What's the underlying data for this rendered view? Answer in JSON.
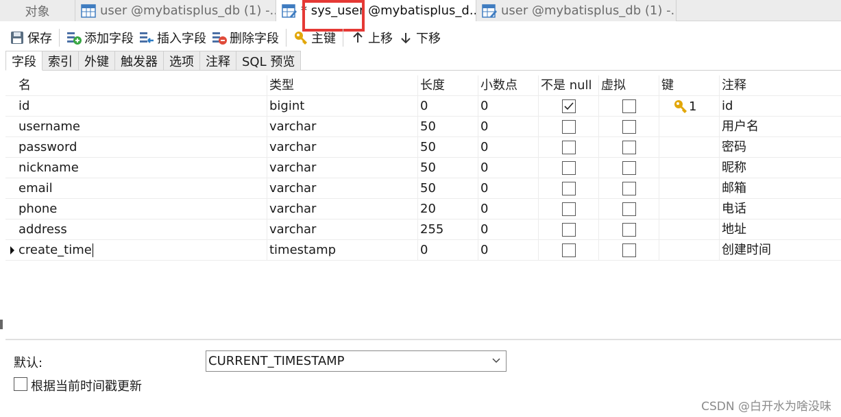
{
  "doc_tabs": [
    {
      "label": "对象"
    },
    {
      "label": "user @mybatisplus_db (1) -..."
    },
    {
      "label": "* sys_user @mybatisplus_d..."
    },
    {
      "label": "user @mybatisplus_db (1) -..."
    }
  ],
  "toolbar": {
    "save": "保存",
    "add_field": "添加字段",
    "insert_field": "插入字段",
    "delete_field": "删除字段",
    "primary_key": "主键",
    "move_up": "上移",
    "move_down": "下移"
  },
  "sub_tabs": [
    "字段",
    "索引",
    "外键",
    "触发器",
    "选项",
    "注释",
    "SQL 预览"
  ],
  "columns": {
    "name": "名",
    "type": "类型",
    "length": "长度",
    "decimals": "小数点",
    "not_null": "不是 null",
    "virtual": "虚拟",
    "key": "键",
    "comment": "注释"
  },
  "rows": [
    {
      "name": "id",
      "type": "bigint",
      "length": "0",
      "decimals": "0",
      "not_null": true,
      "virtual": false,
      "key": "1",
      "comment": "id"
    },
    {
      "name": "username",
      "type": "varchar",
      "length": "50",
      "decimals": "0",
      "not_null": false,
      "virtual": false,
      "key": "",
      "comment": "用户名"
    },
    {
      "name": "password",
      "type": "varchar",
      "length": "50",
      "decimals": "0",
      "not_null": false,
      "virtual": false,
      "key": "",
      "comment": "密码"
    },
    {
      "name": "nickname",
      "type": "varchar",
      "length": "50",
      "decimals": "0",
      "not_null": false,
      "virtual": false,
      "key": "",
      "comment": "昵称"
    },
    {
      "name": "email",
      "type": "varchar",
      "length": "50",
      "decimals": "0",
      "not_null": false,
      "virtual": false,
      "key": "",
      "comment": "邮箱"
    },
    {
      "name": "phone",
      "type": "varchar",
      "length": "20",
      "decimals": "0",
      "not_null": false,
      "virtual": false,
      "key": "",
      "comment": "电话"
    },
    {
      "name": "address",
      "type": "varchar",
      "length": "255",
      "decimals": "0",
      "not_null": false,
      "virtual": false,
      "key": "",
      "comment": "地址"
    },
    {
      "name": "create_time",
      "type": "timestamp",
      "length": "0",
      "decimals": "0",
      "not_null": false,
      "virtual": false,
      "key": "",
      "comment": "创建时间"
    }
  ],
  "bottom": {
    "default_label": "默认:",
    "default_value": "CURRENT_TIMESTAMP",
    "update_label": "根据当前时间戳更新",
    "update_checked": false
  },
  "watermark": "CSDN @白开水为啥没味",
  "colors": {
    "highlight": "#e53935",
    "key_icon": "#e2a70a"
  }
}
